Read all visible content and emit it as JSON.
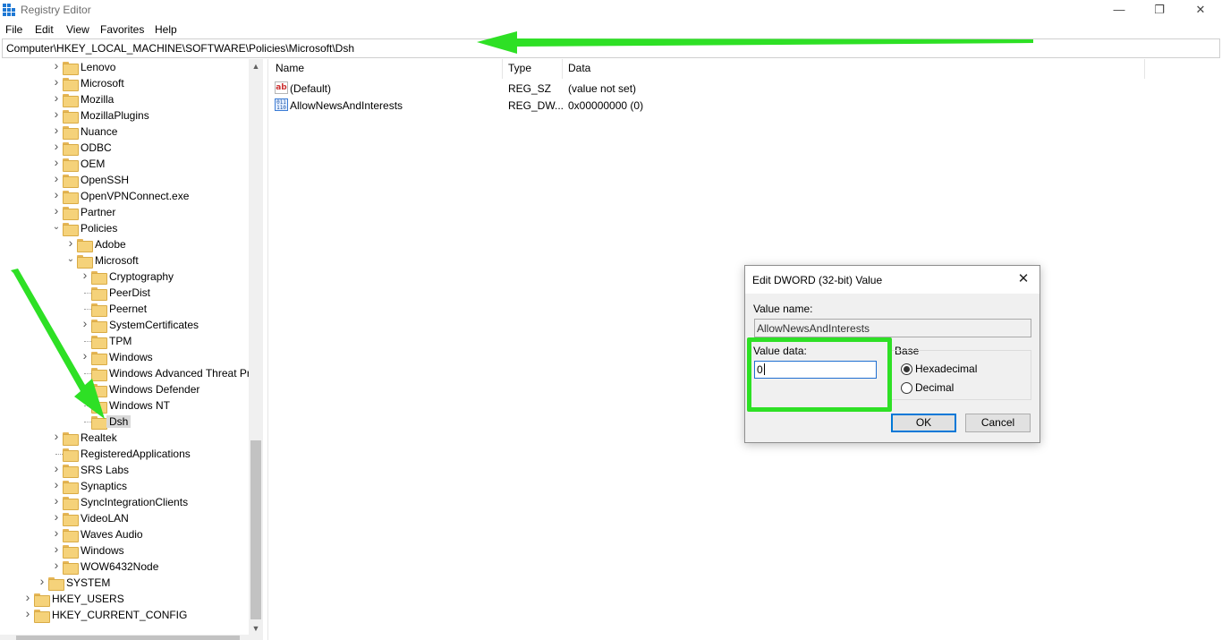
{
  "window": {
    "title": "Registry Editor",
    "minimize_glyph": "—",
    "maximize_glyph": "❐",
    "close_glyph": "✕"
  },
  "menu": [
    {
      "label": "File"
    },
    {
      "label": "Edit"
    },
    {
      "label": "View"
    },
    {
      "label": "Favorites"
    },
    {
      "label": "Help"
    }
  ],
  "address": "Computer\\HKEY_LOCAL_MACHINE\\SOFTWARE\\Policies\\Microsoft\\Dsh",
  "tree": [
    {
      "label": "Lenovo",
      "level": 2,
      "expander": "collapsed"
    },
    {
      "label": "Microsoft",
      "level": 2,
      "expander": "collapsed"
    },
    {
      "label": "Mozilla",
      "level": 2,
      "expander": "collapsed"
    },
    {
      "label": "MozillaPlugins",
      "level": 2,
      "expander": "collapsed"
    },
    {
      "label": "Nuance",
      "level": 2,
      "expander": "collapsed"
    },
    {
      "label": "ODBC",
      "level": 2,
      "expander": "collapsed"
    },
    {
      "label": "OEM",
      "level": 2,
      "expander": "collapsed"
    },
    {
      "label": "OpenSSH",
      "level": 2,
      "expander": "collapsed"
    },
    {
      "label": "OpenVPNConnect.exe",
      "level": 2,
      "expander": "collapsed"
    },
    {
      "label": "Partner",
      "level": 2,
      "expander": "collapsed"
    },
    {
      "label": "Policies",
      "level": 2,
      "expander": "expanded"
    },
    {
      "label": "Adobe",
      "level": 3,
      "expander": "collapsed"
    },
    {
      "label": "Microsoft",
      "level": 3,
      "expander": "expanded"
    },
    {
      "label": "Cryptography",
      "level": 4,
      "expander": "collapsed"
    },
    {
      "label": "PeerDist",
      "level": 4,
      "expander": "none"
    },
    {
      "label": "Peernet",
      "level": 4,
      "expander": "none"
    },
    {
      "label": "SystemCertificates",
      "level": 4,
      "expander": "collapsed"
    },
    {
      "label": "TPM",
      "level": 4,
      "expander": "none"
    },
    {
      "label": "Windows",
      "level": 4,
      "expander": "collapsed"
    },
    {
      "label": "Windows Advanced Threat Pr",
      "level": 4,
      "expander": "none"
    },
    {
      "label": "Windows Defender",
      "level": 4,
      "expander": "none"
    },
    {
      "label": "Windows NT",
      "level": 4,
      "expander": "none"
    },
    {
      "label": "Dsh",
      "level": 4,
      "expander": "none",
      "selected": true
    },
    {
      "label": "Realtek",
      "level": 2,
      "expander": "collapsed"
    },
    {
      "label": "RegisteredApplications",
      "level": 2,
      "expander": "none"
    },
    {
      "label": "SRS Labs",
      "level": 2,
      "expander": "collapsed"
    },
    {
      "label": "Synaptics",
      "level": 2,
      "expander": "collapsed"
    },
    {
      "label": "SyncIntegrationClients",
      "level": 2,
      "expander": "collapsed"
    },
    {
      "label": "VideoLAN",
      "level": 2,
      "expander": "collapsed"
    },
    {
      "label": "Waves Audio",
      "level": 2,
      "expander": "collapsed"
    },
    {
      "label": "Windows",
      "level": 2,
      "expander": "collapsed"
    },
    {
      "label": "WOW6432Node",
      "level": 2,
      "expander": "collapsed"
    },
    {
      "label": "SYSTEM",
      "level": 1,
      "expander": "collapsed"
    },
    {
      "label": "HKEY_USERS",
      "level": 0,
      "expander": "collapsed"
    },
    {
      "label": "HKEY_CURRENT_CONFIG",
      "level": 0,
      "expander": "collapsed"
    }
  ],
  "list": {
    "headers": {
      "name": "Name",
      "type": "Type",
      "data": "Data"
    },
    "rows": [
      {
        "name": "(Default)",
        "type": "REG_SZ",
        "data": "(value not set)",
        "icon": "string-value-icon",
        "icon_glyph": "ab"
      },
      {
        "name": "AllowNewsAndInterests",
        "type": "REG_DW...",
        "data": "0x00000000 (0)",
        "icon": "dword-value-icon",
        "icon_glyph": "011 110"
      }
    ]
  },
  "dialog": {
    "title": "Edit DWORD (32-bit) Value",
    "close_glyph": "✕",
    "value_name_label": "Value name:",
    "value_name": "AllowNewsAndInterests",
    "value_data_label": "Value data:",
    "value_data": "0",
    "base_label": "Base",
    "base_options": [
      {
        "label": "Hexadecimal",
        "checked": true
      },
      {
        "label": "Decimal",
        "checked": false
      }
    ],
    "ok_label": "OK",
    "cancel_label": "Cancel"
  },
  "annotations": {
    "arrow_color": "#2ee025"
  }
}
